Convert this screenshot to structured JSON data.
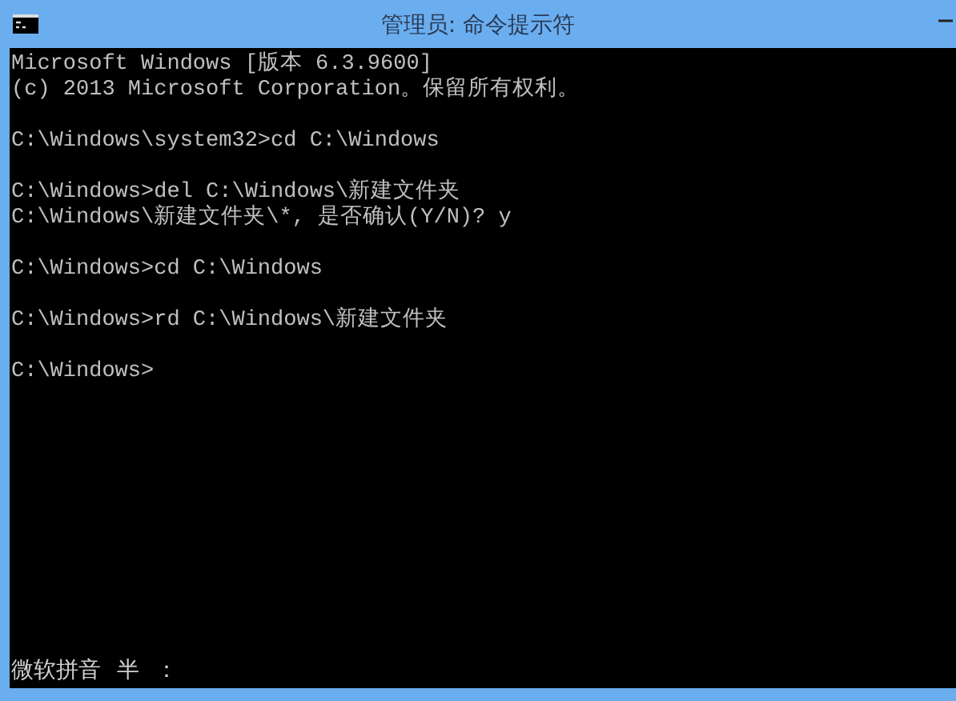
{
  "window": {
    "title": "管理员: 命令提示符"
  },
  "console": {
    "blocks": [
      [
        "Microsoft Windows [版本 6.3.9600]",
        "(c) 2013 Microsoft Corporation。保留所有权利。"
      ],
      [
        "C:\\Windows\\system32>cd C:\\Windows"
      ],
      [
        "C:\\Windows>del C:\\Windows\\新建文件夹",
        "C:\\Windows\\新建文件夹\\*, 是否确认(Y/N)? y"
      ],
      [
        "C:\\Windows>cd C:\\Windows"
      ],
      [
        "C:\\Windows>rd C:\\Windows\\新建文件夹"
      ],
      [
        "C:\\Windows>"
      ]
    ]
  },
  "ime_bar": {
    "name": "微软拼音",
    "mode": "半",
    "punctuation": "："
  }
}
